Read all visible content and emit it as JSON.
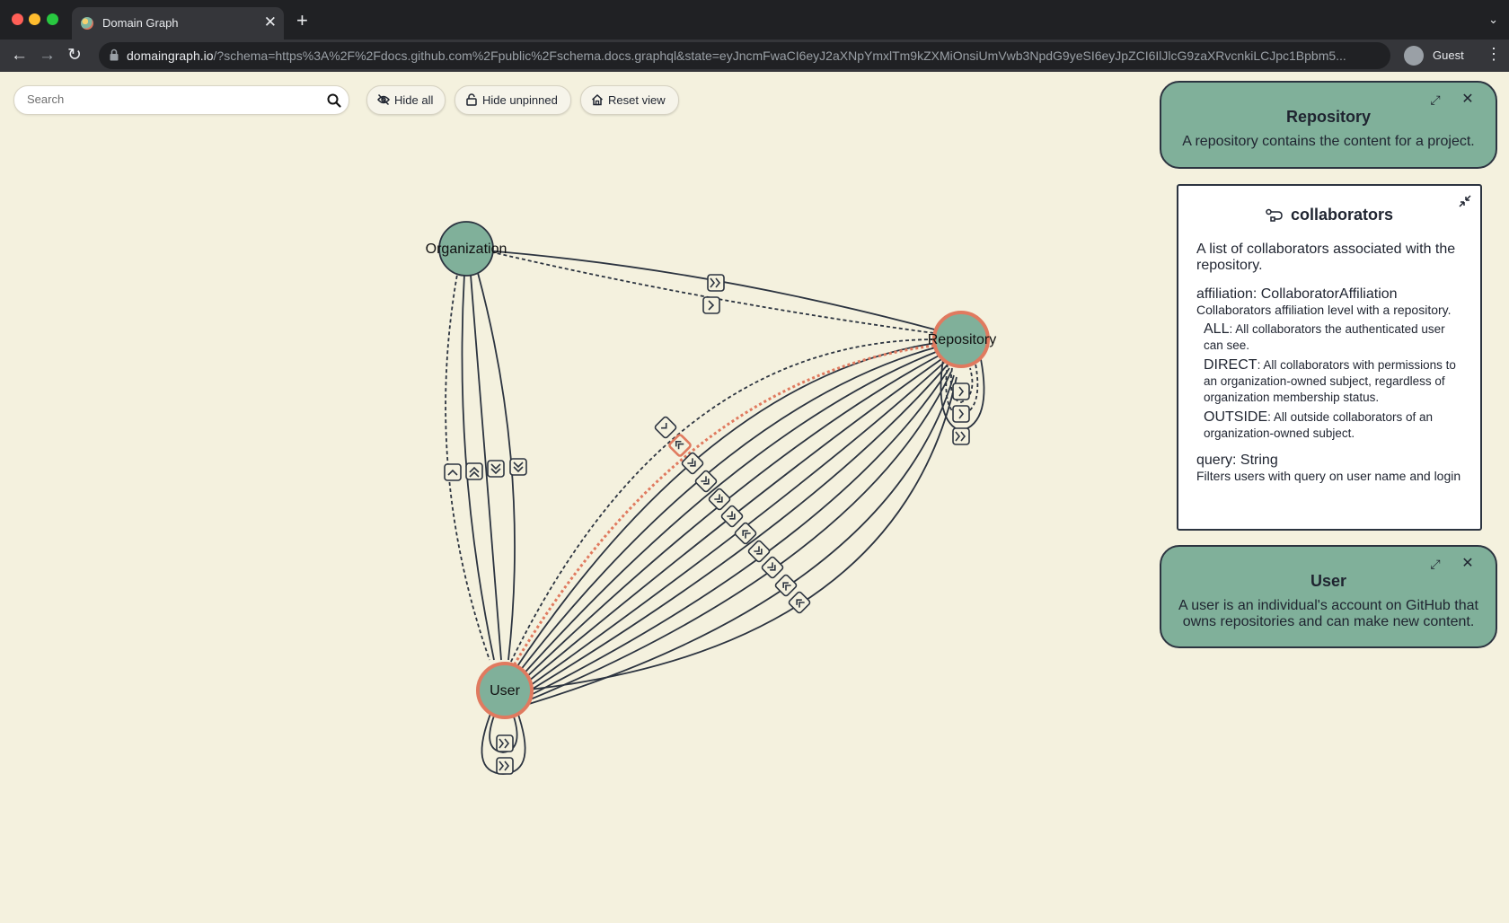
{
  "browser": {
    "tab_title": "Domain Graph",
    "tab_close": "✕",
    "new_tab": "+",
    "tab_menu": "⌄",
    "url_host": "domaingraph.io",
    "url_rest": "/?schema=https%3A%2F%2Fdocs.github.com%2Fpublic%2Fschema.docs.graphql&state=eyJncmFwaCI6eyJ2aXNpYmxlTm9kZXMiOnsiUmVwb3NpdG9yeSI6eyJpZCI6IlJlcG9zaXRvcnkiLCJpc1Bpbm5...",
    "profile_label": "Guest",
    "nav_back": "←",
    "nav_forward": "→",
    "nav_reload": "↻",
    "menu": "⋮"
  },
  "toolbar": {
    "search_placeholder": "Search",
    "hide_all_label": "Hide all",
    "hide_unpinned_label": "Hide unpinned",
    "reset_view_label": "Reset view"
  },
  "graph": {
    "nodes": {
      "organization": "Organization",
      "repository": "Repository",
      "user": "User"
    },
    "colors": {
      "node_fill": "#80b09a",
      "selected_ring": "#e07a5f",
      "edge": "#2c3440",
      "background": "#f4f1de"
    }
  },
  "panels": {
    "repository": {
      "title": "Repository",
      "description": "A repository contains the content for a project.",
      "expand_icon": "⤢",
      "close_icon": "✕"
    },
    "collaborators": {
      "title": "collaborators",
      "description": "A list of collaborators associated with the repository.",
      "args": [
        {
          "signature": "affiliation: CollaboratorAffiliation",
          "description": "Collaborators affiliation level with a repository.",
          "values": [
            {
              "name": "ALL",
              "description": ": All collaborators the authenticated user can see."
            },
            {
              "name": "DIRECT",
              "description": ": All collaborators with permissions to an organization-owned subject, regardless of organization membership status."
            },
            {
              "name": "OUTSIDE",
              "description": ": All outside collaborators of an organization-owned subject."
            }
          ]
        },
        {
          "signature": "query: String",
          "description": "Filters users with query on user name and login",
          "values": []
        }
      ]
    },
    "user": {
      "title": "User",
      "description": "A user is an individual's account on GitHub that owns repositories and can make new content.",
      "expand_icon": "⤢",
      "close_icon": "✕"
    }
  }
}
